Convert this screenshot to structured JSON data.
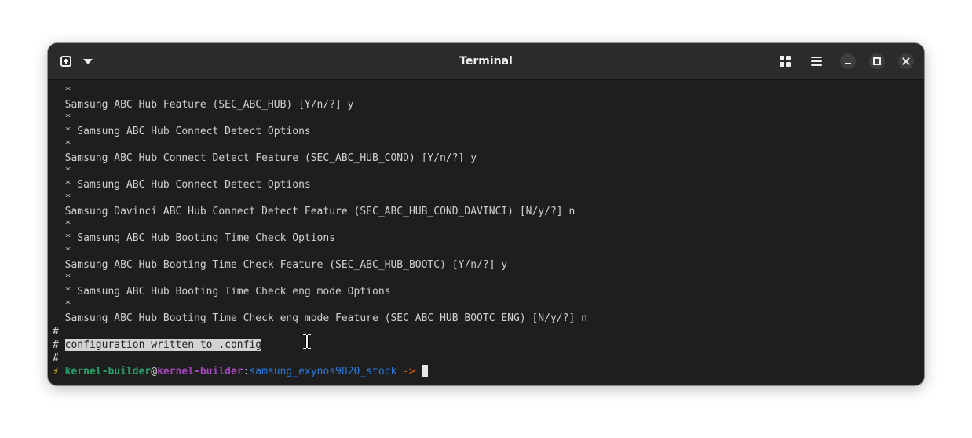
{
  "window": {
    "title": "Terminal"
  },
  "icons": {
    "new_tab": "new-tab-icon",
    "dropdown": "chevron-down-icon",
    "grid": "grid-view-icon",
    "menu": "hamburger-menu-icon",
    "minimize": "minimize-icon",
    "maximize": "maximize-icon",
    "close": "close-icon"
  },
  "terminal": {
    "lines": [
      "  *",
      "  Samsung ABC Hub Feature (SEC_ABC_HUB) [Y/n/?] y",
      "  *",
      "  * Samsung ABC Hub Connect Detect Options",
      "  *",
      "  Samsung ABC Hub Connect Detect Feature (SEC_ABC_HUB_COND) [Y/n/?] y",
      "  *",
      "  * Samsung ABC Hub Connect Detect Options",
      "  *",
      "  Samsung Davinci ABC Hub Connect Detect Feature (SEC_ABC_HUB_COND_DAVINCI) [N/y/?] n",
      "  *",
      "  * Samsung ABC Hub Booting Time Check Options",
      "  *",
      "  Samsung ABC Hub Booting Time Check Feature (SEC_ABC_HUB_BOOTC) [Y/n/?] y",
      "  *",
      "  * Samsung ABC Hub Booting Time Check eng mode Options",
      "  *",
      "  Samsung ABC Hub Booting Time Check eng mode Feature (SEC_ABC_HUB_BOOTC_ENG) [N/y/?] n",
      "#"
    ],
    "config_prefix": "# ",
    "config_message": "configuration written to .config",
    "trailing_hash": "#",
    "prompt": {
      "bolt": "⚡ ",
      "user": "kernel-builder",
      "at": "@",
      "host": "kernel-builder",
      "colon": ":",
      "path": "samsung_exynos9820_stock",
      "arrow": " -> "
    }
  },
  "colors": {
    "background": "#1e1e1e",
    "titlebar": "#2b2b2b",
    "user": "#26a269",
    "host": "#a347ba",
    "path": "#2a7bde",
    "arrow": "#e66100",
    "bolt": "#e5c000"
  }
}
